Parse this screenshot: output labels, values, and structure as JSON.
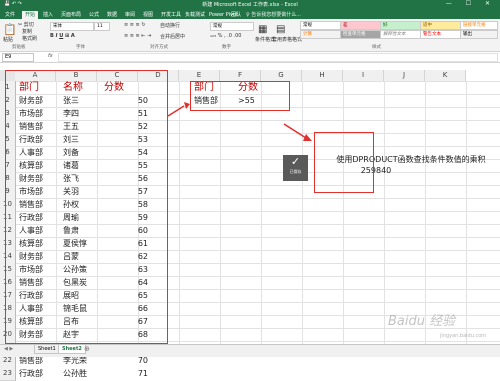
{
  "window": {
    "title": "新建 Microsoft Excel 工作表.xlsx - Excel",
    "controls": "— ☐ ✕"
  },
  "ribbon_tabs": [
    "文件",
    "开始",
    "插入",
    "页面布局",
    "公式",
    "数据",
    "审阅",
    "视图",
    "开发工具",
    "负载测试",
    "Power Pivot",
    "团队"
  ],
  "tell_me": "♀ 告诉我您想要做什么...",
  "ribbon": {
    "paste": "粘贴",
    "cut": "✂ 剪切",
    "copy": "复制",
    "format_painter": "格式刷",
    "clipboard_group": "剪贴板",
    "font_name": "宋体",
    "font_size": "11",
    "font_group": "字体",
    "align_group": "对齐方式",
    "wrap": "自动换行",
    "merge": "合并后居中",
    "number_format": "常规",
    "number_group": "数字",
    "cond_format": "条件格式",
    "table_format": "套用表格格式",
    "style_normal": "常规",
    "style_bad": "差",
    "style_good": "好",
    "style_neutral": "适中",
    "style_calc": "计算",
    "style_check": "检查单元格",
    "style_explain": "解释性文本",
    "style_warn": "警告文本",
    "style_link": "链接单元格",
    "style_output": "输出",
    "styles_group": "样式"
  },
  "formula_bar": {
    "name_box": "E9",
    "fx": "fx",
    "value": ""
  },
  "columns": [
    "A",
    "B",
    "C",
    "D",
    "E",
    "F",
    "G",
    "H",
    "I",
    "J",
    "K"
  ],
  "rows": [
    "1",
    "2",
    "3",
    "4",
    "5",
    "6",
    "7",
    "8",
    "9",
    "10",
    "11",
    "12",
    "13",
    "14",
    "15",
    "16",
    "17",
    "18",
    "19",
    "20",
    "21",
    "22",
    "23"
  ],
  "table": {
    "headers": [
      "部门",
      "名称",
      "分数"
    ],
    "records": [
      [
        "财务部",
        "张三",
        "50"
      ],
      [
        "市场部",
        "李四",
        "51"
      ],
      [
        "销售部",
        "王五",
        "52"
      ],
      [
        "行政部",
        "刘三",
        "53"
      ],
      [
        "人事部",
        "刘备",
        "54"
      ],
      [
        "核算部",
        "诸葛",
        "55"
      ],
      [
        "财务部",
        "张飞",
        "56"
      ],
      [
        "市场部",
        "关羽",
        "57"
      ],
      [
        "销售部",
        "孙权",
        "58"
      ],
      [
        "行政部",
        "周瑜",
        "59"
      ],
      [
        "人事部",
        "鲁肃",
        "60"
      ],
      [
        "核算部",
        "夏侯惇",
        "61"
      ],
      [
        "财务部",
        "吕蒙",
        "62"
      ],
      [
        "市场部",
        "公孙策",
        "63"
      ],
      [
        "销售部",
        "包黑炭",
        "64"
      ],
      [
        "行政部",
        "展昭",
        "65"
      ],
      [
        "人事部",
        "锦毛鼠",
        "66"
      ],
      [
        "核算部",
        "吕布",
        "67"
      ],
      [
        "财务部",
        "赵宇",
        "68"
      ],
      [
        "市场部",
        "武松",
        "69"
      ],
      [
        "销售部",
        "李光荣",
        "70"
      ],
      [
        "行政部",
        "公孙胜",
        "71"
      ]
    ]
  },
  "criteria": {
    "headers": [
      "部门",
      "分数"
    ],
    "values": [
      "销售部",
      ">55"
    ]
  },
  "result": {
    "caption": "使用DPRODUCT函数查找条件数值的乘积",
    "value": "259840"
  },
  "cursor_label": "已保存",
  "sheets": [
    "Sheet1",
    "Sheet2"
  ],
  "watermark": "Baidu 经验",
  "watermark_sub": "jingyan.baidu.com"
}
